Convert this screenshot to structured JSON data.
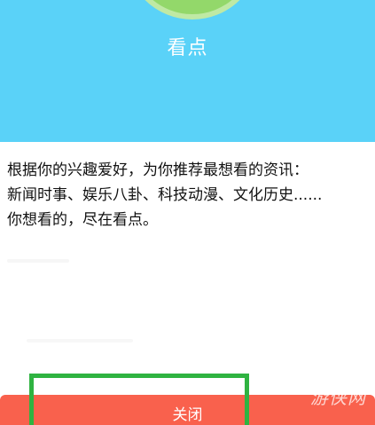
{
  "header": {
    "title": "看点"
  },
  "description": {
    "lines": [
      "根据你的兴趣爱好，为你推荐最想看的资讯：",
      "新闻时事、娱乐八卦、科技动漫、文化历史......",
      "你想看的，尽在看点。"
    ]
  },
  "footer": {
    "close_label": "关闭"
  },
  "watermark": {
    "text": "游侠网"
  },
  "colors": {
    "header_bg": "#5ad2f8",
    "close_button_bg": "#f9614d",
    "highlight_border": "#2fb341"
  }
}
